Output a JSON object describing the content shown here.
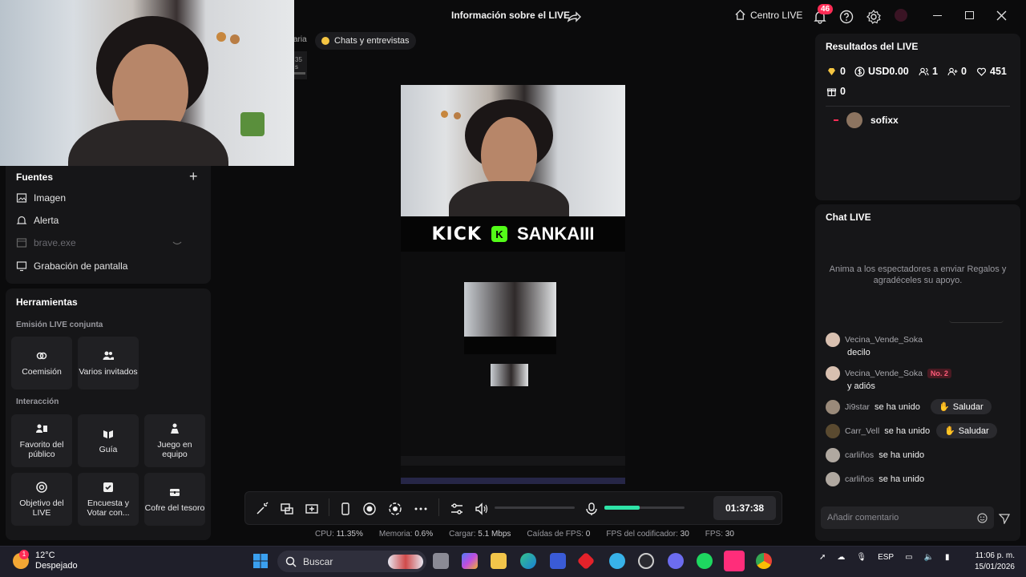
{
  "window": {
    "title": "Información sobre el LIVE",
    "centro_label": "Centro LIVE",
    "notifications_count": "46"
  },
  "scene": {
    "tab_partial": "aria",
    "tab_label": "Chats y entrevistas",
    "partial_text": "35 s"
  },
  "fuentes": {
    "title": "Fuentes",
    "items": [
      {
        "label": "Imagen",
        "icon": "image-icon",
        "enabled": true
      },
      {
        "label": "Alerta",
        "icon": "bell-icon",
        "enabled": true
      },
      {
        "label": "brave.exe",
        "icon": "window-icon",
        "enabled": false
      },
      {
        "label": "Grabación de pantalla",
        "icon": "monitor-icon",
        "enabled": true
      }
    ]
  },
  "herramientas": {
    "title": "Herramientas",
    "section_joint": "Emisión LIVE conjunta",
    "section_interaction": "Interacción",
    "tools_joint": [
      {
        "label": "Coemisión",
        "icon": "link-icon"
      },
      {
        "label": "Varios invitados",
        "icon": "guests-icon"
      }
    ],
    "tools_interaction": [
      {
        "label": "Favorito del público",
        "icon": "favorite-icon"
      },
      {
        "label": "Guía",
        "icon": "guide-icon"
      },
      {
        "label": "Juego en equipo",
        "icon": "team-game-icon"
      },
      {
        "label": "Objetivo del LIVE",
        "icon": "target-icon"
      },
      {
        "label": "Encuesta y Votar con...",
        "icon": "poll-icon"
      },
      {
        "label": "Cofre del tesoro",
        "icon": "chest-icon"
      }
    ]
  },
  "preview": {
    "banner_left": "KICK",
    "banner_logo": "K",
    "banner_right": "SANKAIII"
  },
  "controls": {
    "timer": "01:37:38",
    "volume_level": 0,
    "mic_level": 0.44
  },
  "stats": {
    "cpu_label": "CPU:",
    "cpu": "11.35%",
    "mem_label": "Memoria:",
    "mem": "0.6%",
    "upload_label": "Cargar:",
    "upload": "5.1 Mbps",
    "fps_drop_label": "Caídas de FPS:",
    "fps_drop": "0",
    "enc_fps_label": "FPS del codificador:",
    "enc_fps": "30",
    "fps_label": "FPS:",
    "fps": "30"
  },
  "results": {
    "title": "Resultados del LIVE",
    "diamonds": "0",
    "usd": "USD0.00",
    "viewers": "1",
    "new_followers": "0",
    "likes": "451",
    "gifts": "0",
    "viewer_name": "sofixx"
  },
  "chat": {
    "title": "Chat LIVE",
    "hint": "Anima a los espectadores a enviar Regalos y agradéceles su apoyo.",
    "messages": [
      {
        "user": "Vecina_Vende_Soka",
        "text": "decilo"
      },
      {
        "user": "Vecina_Vende_Soka",
        "badge": "No. 2",
        "text": "y adiós"
      }
    ],
    "joins": [
      {
        "user": "Ji9star",
        "text": "se ha unido",
        "action": "Saludar"
      },
      {
        "user": "Carr_Vell",
        "text": "se ha unido",
        "action": "Saludar"
      },
      {
        "user": "carliños",
        "text": "se ha unido"
      },
      {
        "user": "carliños",
        "text": "se ha unido"
      }
    ],
    "comment_placeholder": "Añadir comentario"
  },
  "taskbar": {
    "temp": "12°C",
    "weather": "Despejado",
    "search_placeholder": "Buscar",
    "lang": "ESP",
    "time": "11:06 p. m.",
    "date": "15/01/2026"
  }
}
